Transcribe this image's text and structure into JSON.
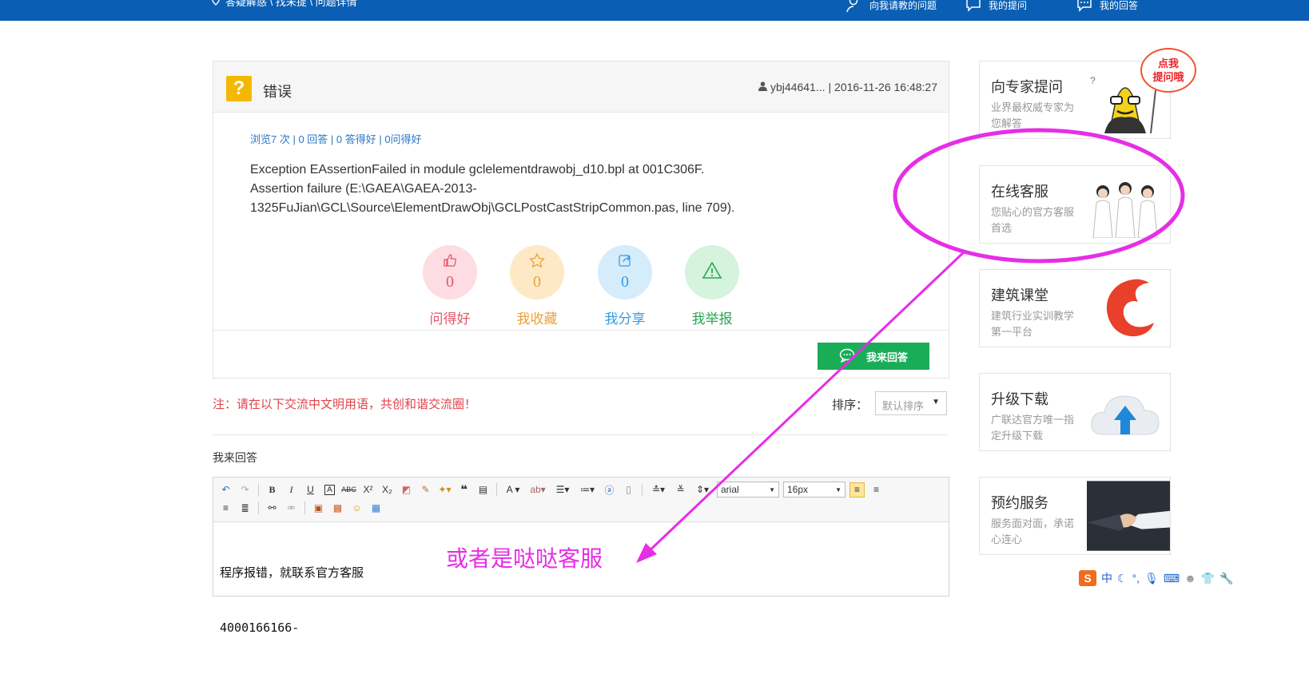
{
  "topbar": {
    "breadcrumb": "答疑解惑 \\ 找未提 \\ 问题详情",
    "links": [
      "向我请教的问题",
      "我的提问",
      "我的回答"
    ]
  },
  "question": {
    "title": "错误",
    "user": "ybj44641...",
    "time": "| 2016-11-26 16:48:27",
    "stats": "浏览7 次 | 0 回答 | 0 答得好 | 0问得好",
    "body_lines": [
      "Exception EAssertionFailed in module gclelementdrawobj_d10.bpl at 001C306F.",
      "Assertion failure (E:\\GAEA\\GAEA-2013-",
      "1325FuJian\\GCL\\Source\\ElementDrawObj\\GCLPostCastStripCommon.pas, line 709)."
    ],
    "actions": [
      {
        "label": "问得好",
        "count": "0",
        "color": "#e4566a",
        "bg": "#fddde3"
      },
      {
        "label": "我收藏",
        "count": "0",
        "color": "#e9a23b",
        "bg": "#fde9c6"
      },
      {
        "label": "我分享",
        "count": "0",
        "color": "#3a9be0",
        "bg": "#d5ecfb"
      },
      {
        "label": "我举报",
        "count": "",
        "color": "#2aa852",
        "bg": "#d6f3dd"
      }
    ],
    "answer_button": "我来回答"
  },
  "notice": "注：请在以下交流中文明用语，共创和谐交流圈！",
  "sort": {
    "label": "排序：",
    "selected": "默认排序"
  },
  "my_answer_label": "我来回答",
  "editor": {
    "font_name": "arial",
    "font_size": "16px",
    "content_lines": [
      "程序报错，就联系官方客服",
      "4000166166-"
    ]
  },
  "annotation": "或者是哒哒客服",
  "sidebar": {
    "bubble": [
      "点我",
      "提问哦"
    ],
    "cards": [
      {
        "title": "向专家提问",
        "desc": "业界最权威专家为您解答"
      },
      {
        "title": "在线客服",
        "desc": "您贴心的官方客服首选"
      },
      {
        "title": "建筑课堂",
        "desc": "建筑行业实训教学第一平台"
      },
      {
        "title": "升级下载",
        "desc": "广联达官方唯一指定升级下载"
      },
      {
        "title": "预约服务",
        "desc": "服务面对面，承诺心连心"
      }
    ]
  },
  "ime": {
    "mode": "中"
  },
  "colors": {
    "topbar": "#0a5fb4",
    "annotation": "#e62ee6",
    "answer_button": "#1aad57",
    "notice": "#e0434a"
  }
}
